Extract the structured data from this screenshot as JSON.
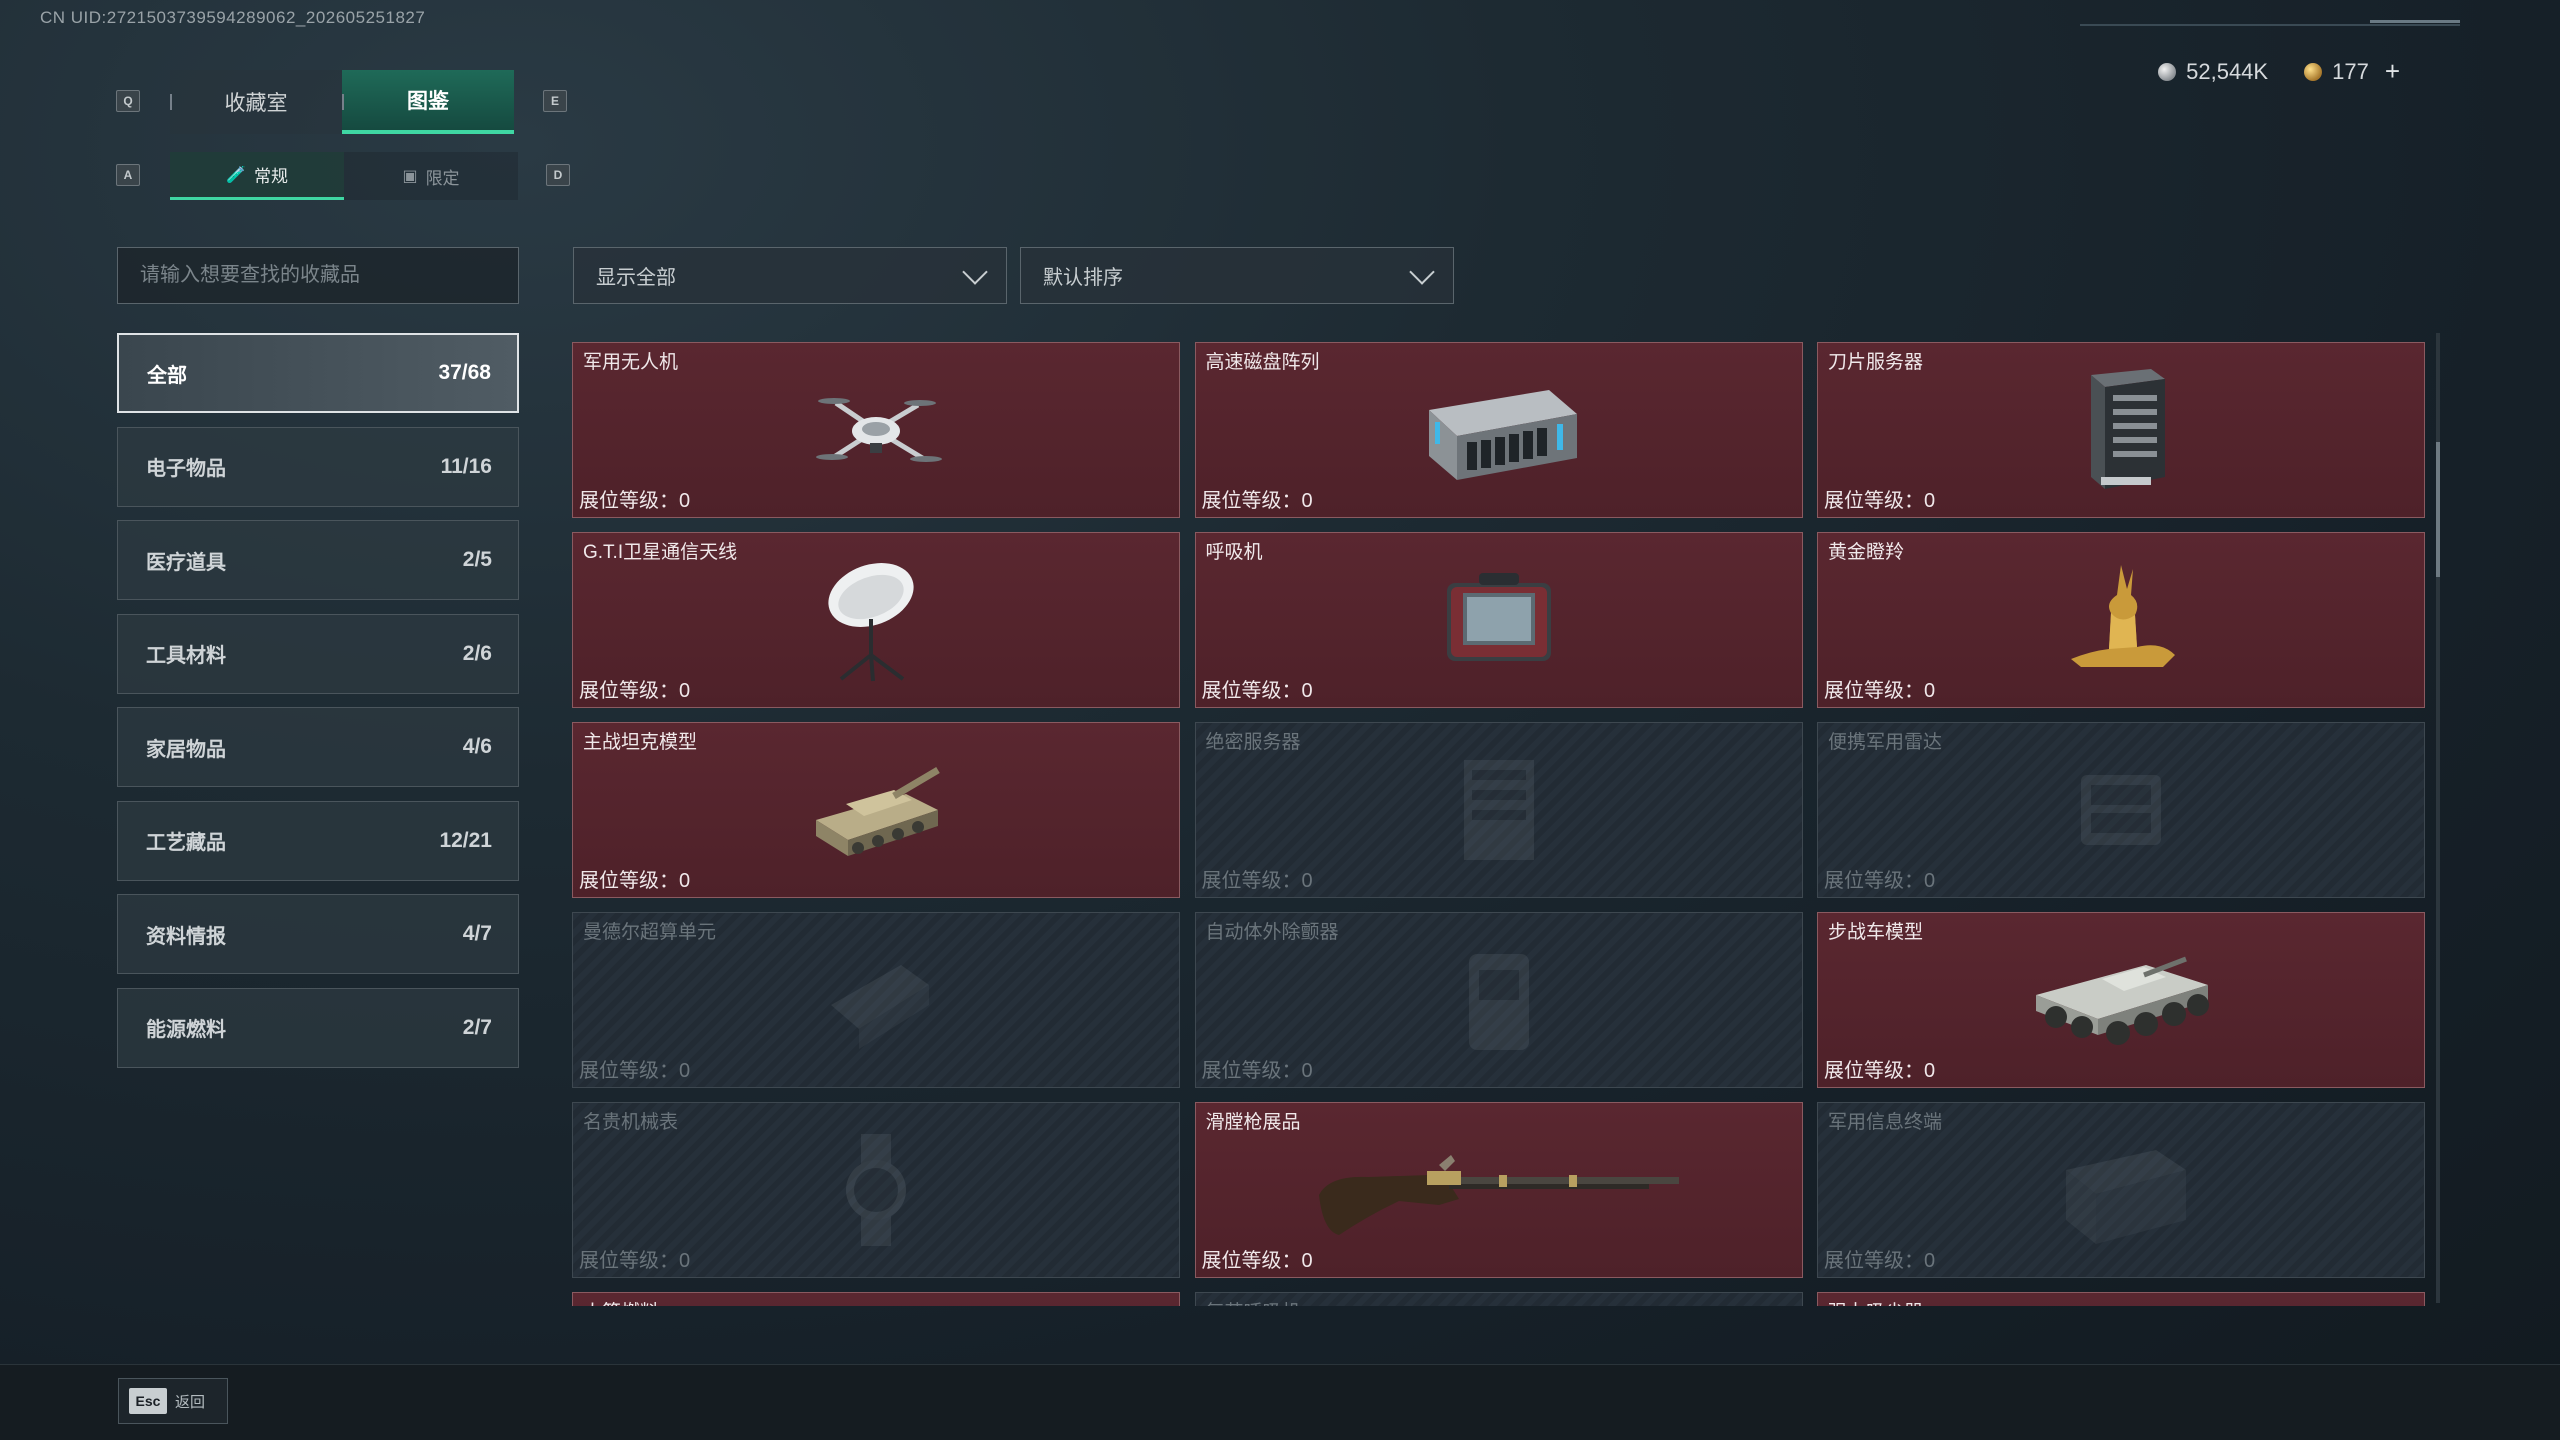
{
  "uid_text": "CN UID:2721503739594289062_202605251827",
  "currency": {
    "silver": "52,544K",
    "gold": "177",
    "plus": "+"
  },
  "keys": {
    "q": "Q",
    "e": "E",
    "a": "A",
    "d": "D"
  },
  "main_tabs": [
    {
      "label": "收藏室"
    },
    {
      "label": "图鉴"
    }
  ],
  "sub_tabs": [
    {
      "label": "常规",
      "icon": "bottle-icon"
    },
    {
      "label": "限定",
      "icon": "image-icon"
    }
  ],
  "search": {
    "placeholder": "请输入想要查找的收藏品"
  },
  "filter": {
    "selected": "显示全部"
  },
  "sort": {
    "selected": "默认排序"
  },
  "categories": [
    {
      "label": "全部",
      "count": "37/68"
    },
    {
      "label": "电子物品",
      "count": "11/16"
    },
    {
      "label": "医疗道具",
      "count": "2/5"
    },
    {
      "label": "工具材料",
      "count": "2/6"
    },
    {
      "label": "家居物品",
      "count": "4/6"
    },
    {
      "label": "工艺藏品",
      "count": "12/21"
    },
    {
      "label": "资料情报",
      "count": "4/7"
    },
    {
      "label": "能源燃料",
      "count": "2/7"
    }
  ],
  "items": [
    {
      "name": "军用无人机",
      "level": "展位等级：0",
      "owned": true,
      "icon": "drone-icon"
    },
    {
      "name": "高速磁盘阵列",
      "level": "展位等级：0",
      "owned": true,
      "icon": "disk-array-icon"
    },
    {
      "name": "刀片服务器",
      "level": "展位等级：0",
      "owned": true,
      "icon": "blade-server-icon"
    },
    {
      "name": "G.T.I卫星通信天线",
      "level": "展位等级：0",
      "owned": true,
      "icon": "satellite-dish-icon"
    },
    {
      "name": "呼吸机",
      "level": "展位等级：0",
      "owned": true,
      "icon": "ventilator-icon"
    },
    {
      "name": "黄金瞪羚",
      "level": "展位等级：0",
      "owned": true,
      "icon": "gold-gazelle-icon"
    },
    {
      "name": "主战坦克模型",
      "level": "展位等级：0",
      "owned": true,
      "icon": "tank-model-icon"
    },
    {
      "name": "绝密服务器",
      "level": "展位等级：0",
      "owned": false,
      "icon": "server-icon"
    },
    {
      "name": "便携军用雷达",
      "level": "展位等级：0",
      "owned": false,
      "icon": "radar-icon"
    },
    {
      "name": "曼德尔超算单元",
      "level": "展位等级：0",
      "owned": false,
      "icon": "supercomputer-icon"
    },
    {
      "name": "自动体外除颤器",
      "level": "展位等级：0",
      "owned": false,
      "icon": "defibrillator-icon"
    },
    {
      "name": "步战车模型",
      "level": "展位等级：0",
      "owned": true,
      "icon": "ifv-model-icon"
    },
    {
      "name": "名贵机械表",
      "level": "展位等级：0",
      "owned": false,
      "icon": "watch-icon"
    },
    {
      "name": "滑膛枪展品",
      "level": "展位等级：0",
      "owned": true,
      "icon": "musket-icon"
    },
    {
      "name": "军用信息终端",
      "level": "展位等级：0",
      "owned": false,
      "icon": "terminal-icon"
    },
    {
      "name": "火箭燃料",
      "level": "",
      "owned": true,
      "icon": ""
    },
    {
      "name": "复苏呼吸机",
      "level": "",
      "owned": false,
      "icon": ""
    },
    {
      "name": "强力吸尘器",
      "level": "",
      "owned": true,
      "icon": ""
    }
  ],
  "footer": {
    "esc_key": "Esc",
    "back_label": "返回"
  }
}
